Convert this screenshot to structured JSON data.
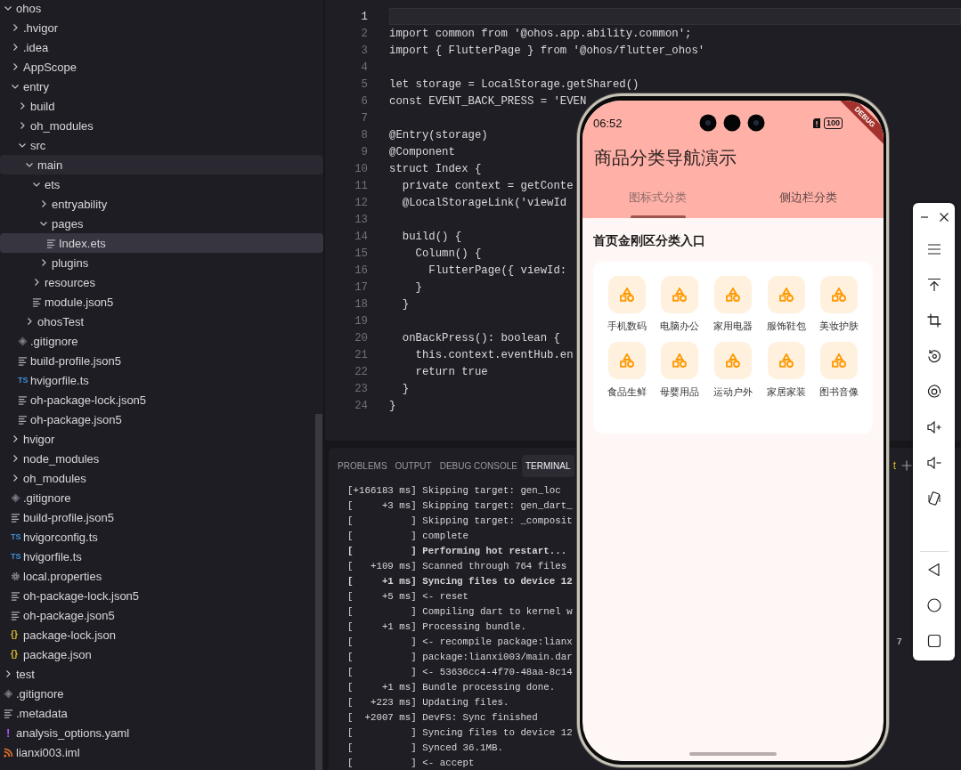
{
  "explorer": {
    "tree": [
      {
        "name": "ohos",
        "kind": "folder",
        "expanded": true,
        "selected": false,
        "hovered": false,
        "children": [
          {
            "name": ".hvigor",
            "kind": "folder",
            "expanded": false,
            "selected": false,
            "hovered": false
          },
          {
            "name": ".idea",
            "kind": "folder",
            "expanded": false,
            "selected": false,
            "hovered": false
          },
          {
            "name": "AppScope",
            "kind": "folder",
            "expanded": false,
            "selected": false,
            "hovered": false
          },
          {
            "name": "entry",
            "kind": "folder",
            "expanded": true,
            "selected": false,
            "hovered": false,
            "children": [
              {
                "name": "build",
                "kind": "folder",
                "expanded": false,
                "selected": false,
                "hovered": false
              },
              {
                "name": "oh_modules",
                "kind": "folder",
                "expanded": false,
                "selected": false,
                "hovered": false
              },
              {
                "name": "src",
                "kind": "folder",
                "expanded": true,
                "selected": false,
                "hovered": false,
                "children": [
                  {
                    "name": "main",
                    "kind": "folder",
                    "expanded": true,
                    "selected": false,
                    "hovered": true,
                    "children": [
                      {
                        "name": "ets",
                        "kind": "folder",
                        "expanded": true,
                        "selected": false,
                        "hovered": false,
                        "children": [
                          {
                            "name": "entryability",
                            "kind": "folder",
                            "expanded": false,
                            "selected": false,
                            "hovered": false
                          },
                          {
                            "name": "pages",
                            "kind": "folder",
                            "expanded": true,
                            "selected": false,
                            "hovered": false,
                            "children": [
                              {
                                "name": "Index.ets",
                                "kind": "file",
                                "selected": true,
                                "hovered": false
                              }
                            ]
                          },
                          {
                            "name": "plugins",
                            "kind": "folder",
                            "expanded": false,
                            "selected": false,
                            "hovered": false
                          }
                        ]
                      },
                      {
                        "name": "resources",
                        "kind": "folder",
                        "expanded": false,
                        "selected": false,
                        "hovered": false
                      },
                      {
                        "name": "module.json5",
                        "kind": "file",
                        "selected": false,
                        "hovered": false
                      }
                    ]
                  },
                  {
                    "name": "ohosTest",
                    "kind": "folder",
                    "expanded": false,
                    "selected": false,
                    "hovered": false
                  }
                ]
              },
              {
                "name": ".gitignore",
                "kind": "git",
                "selected": false,
                "hovered": false
              },
              {
                "name": "build-profile.json5",
                "kind": "file",
                "selected": false,
                "hovered": false
              },
              {
                "name": "hvigorfile.ts",
                "kind": "ts",
                "badge": "TS",
                "selected": false,
                "hovered": false
              },
              {
                "name": "oh-package-lock.json5",
                "kind": "file",
                "selected": false,
                "hovered": false
              },
              {
                "name": "oh-package.json5",
                "kind": "file",
                "selected": false,
                "hovered": false
              }
            ]
          },
          {
            "name": "hvigor",
            "kind": "folder",
            "expanded": false,
            "selected": false,
            "hovered": false
          },
          {
            "name": "node_modules",
            "kind": "folder",
            "expanded": false,
            "selected": false,
            "hovered": false
          },
          {
            "name": "oh_modules",
            "kind": "folder",
            "expanded": false,
            "selected": false,
            "hovered": false
          },
          {
            "name": ".gitignore",
            "kind": "git",
            "selected": false,
            "hovered": false
          },
          {
            "name": "build-profile.json5",
            "kind": "file",
            "selected": false,
            "hovered": false
          },
          {
            "name": "hvigorconfig.ts",
            "kind": "ts",
            "badge": "TS",
            "selected": false,
            "hovered": false
          },
          {
            "name": "hvigorfile.ts",
            "kind": "ts",
            "badge": "TS",
            "selected": false,
            "hovered": false
          },
          {
            "name": "local.properties",
            "kind": "gear",
            "selected": false,
            "hovered": false
          },
          {
            "name": "oh-package-lock.json5",
            "kind": "file",
            "selected": false,
            "hovered": false
          },
          {
            "name": "oh-package.json5",
            "kind": "file",
            "selected": false,
            "hovered": false
          },
          {
            "name": "package-lock.json",
            "kind": "json",
            "badge": "{}",
            "selected": false,
            "hovered": false
          },
          {
            "name": "package.json",
            "kind": "json",
            "badge": "{}",
            "selected": false,
            "hovered": false
          }
        ]
      },
      {
        "name": "test",
        "kind": "folder",
        "expanded": false,
        "selected": false,
        "hovered": false
      },
      {
        "name": ".gitignore",
        "kind": "git",
        "selected": false,
        "hovered": false
      },
      {
        "name": ".metadata",
        "kind": "file",
        "selected": false,
        "hovered": false
      },
      {
        "name": "analysis_options.yaml",
        "kind": "yaml",
        "badge": "!",
        "selected": false,
        "hovered": false
      },
      {
        "name": "lianxi003.iml",
        "kind": "rss",
        "selected": false,
        "hovered": false
      }
    ]
  },
  "editor": {
    "lines": [
      {
        "number": "1",
        "current": true
      },
      {
        "number": "2",
        "text": "import common from '@ohos.app.ability.common';",
        "current": false
      },
      {
        "number": "3",
        "text": "import { FlutterPage } from '@ohos/flutter_ohos'",
        "current": false
      },
      {
        "number": "4",
        "current": false
      },
      {
        "number": "5",
        "text": "let storage = LocalStorage.getShared()",
        "current": false
      },
      {
        "number": "6",
        "text": "const EVENT_BACK_PRESS = 'EVEN",
        "current": false
      },
      {
        "number": "7",
        "current": false
      },
      {
        "number": "8",
        "text": "@Entry(storage)",
        "current": false
      },
      {
        "number": "9",
        "text": "@Component",
        "current": false
      },
      {
        "number": "10",
        "text": "struct Index {",
        "current": false
      },
      {
        "number": "11",
        "text": "  private context = getConte",
        "current": false
      },
      {
        "number": "12",
        "text": "  @LocalStorageLink('viewId",
        "current": false
      },
      {
        "number": "13",
        "current": false
      },
      {
        "number": "14",
        "text": "  build() {",
        "current": false
      },
      {
        "number": "15",
        "text": "    Column() {",
        "current": false
      },
      {
        "number": "16",
        "text": "      FlutterPage({ viewId:",
        "current": false
      },
      {
        "number": "17",
        "text": "    }",
        "current": false
      },
      {
        "number": "18",
        "text": "  }",
        "current": false
      },
      {
        "number": "19",
        "current": false
      },
      {
        "number": "20",
        "text": "  onBackPress(): boolean {",
        "current": false
      },
      {
        "number": "21",
        "text": "    this.context.eventHub.en",
        "current": false
      },
      {
        "number": "22",
        "text": "    return true",
        "current": false
      },
      {
        "number": "23",
        "text": "  }",
        "current": false
      },
      {
        "number": "24",
        "text": "}",
        "current": false
      }
    ]
  },
  "panel": {
    "tabs": [
      {
        "label": "PROBLEMS",
        "selected": false
      },
      {
        "label": "OUTPUT",
        "selected": false
      },
      {
        "label": "DEBUG CONSOLE",
        "selected": false
      },
      {
        "label": "TERMINAL",
        "selected": true
      }
    ],
    "terminal_name": "t",
    "lines": [
      {
        "text": "[+166183 ms] Skipping target: gen_loc",
        "bold": false
      },
      {
        "text": "[     +3 ms] Skipping target: gen_dart_",
        "bold": false
      },
      {
        "text": "[          ] Skipping target: _composit",
        "bold": false
      },
      {
        "text": "[          ] complete",
        "bold": false
      },
      {
        "text": "[          ] Performing hot restart...",
        "bold": true
      },
      {
        "text": "[   +109 ms] Scanned through 764 files",
        "bold": false
      },
      {
        "text": "[     +1 ms] Syncing files to device 12",
        "bold": true
      },
      {
        "text": "[     +5 ms] <- reset",
        "bold": false
      },
      {
        "text": "[          ] Compiling dart to kernel w",
        "bold": false
      },
      {
        "text": "[     +1 ms] Processing bundle.",
        "bold": false
      },
      {
        "text": "[          ] <- recompile package:lianx",
        "bold": false,
        "tail": "7"
      },
      {
        "text": "[          ] package:lianxi003/main.dar",
        "bold": false
      },
      {
        "text": "[          ] <- 53636cc4-4f70-48aa-8c14",
        "bold": false
      },
      {
        "text": "[     +1 ms] Bundle processing done.",
        "bold": false
      },
      {
        "text": "[   +223 ms] Updating files.",
        "bold": false
      },
      {
        "text": "[  +2007 ms] DevFS: Sync finished",
        "bold": false
      },
      {
        "text": "[          ] Syncing files to device 12",
        "bold": false
      },
      {
        "text": "[          ] Synced 36.1MB.",
        "bold": false
      },
      {
        "text": "[          ] <- accept",
        "bold": false
      }
    ]
  },
  "phone": {
    "time": "06:52",
    "battery": "100",
    "debug_banner": "DEBUG",
    "title": "商品分类导航演示",
    "tabs": [
      {
        "label": "图标式分类",
        "selected": true
      },
      {
        "label": "侧边栏分类",
        "selected": false
      }
    ],
    "section_title": "首页金刚区分类入口",
    "categories": [
      {
        "label": "手机数码"
      },
      {
        "label": "电脑办公"
      },
      {
        "label": "家用电器"
      },
      {
        "label": "服饰鞋包"
      },
      {
        "label": "美妆护肤"
      },
      {
        "label": "食品生鲜"
      },
      {
        "label": "母婴用品"
      },
      {
        "label": "运动户外"
      },
      {
        "label": "家居家装"
      },
      {
        "label": "图书音像"
      }
    ]
  }
}
